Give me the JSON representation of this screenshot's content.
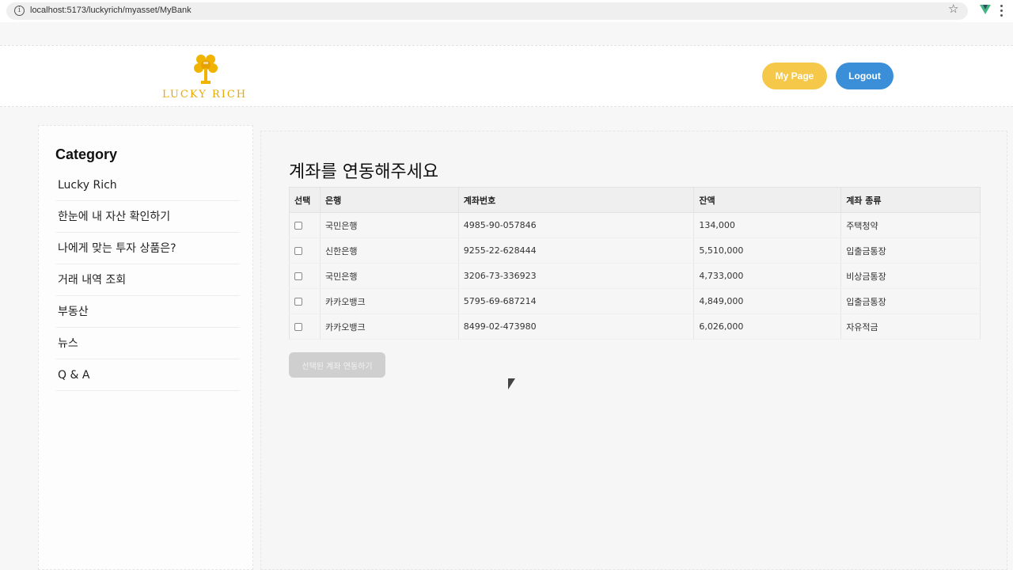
{
  "browser": {
    "url": "localhost:5173/luckyrich/myasset/MyBank"
  },
  "header": {
    "logo_text": "LUCKY RICH",
    "mypage_label": "My Page",
    "logout_label": "Logout"
  },
  "sidebar": {
    "title": "Category",
    "items": [
      {
        "label": "Lucky Rich"
      },
      {
        "label": "한눈에 내 자산 확인하기"
      },
      {
        "label": "나에게 맞는 투자 상품은?"
      },
      {
        "label": "거래 내역 조회"
      },
      {
        "label": "부동산"
      },
      {
        "label": "뉴스"
      },
      {
        "label": "Q & A"
      }
    ]
  },
  "main": {
    "title": "계좌를 연동해주세요",
    "table": {
      "headers": [
        "선택",
        "은행",
        "계좌번호",
        "잔액",
        "계좌 종류"
      ],
      "rows": [
        {
          "bank": "국민은행",
          "account": "4985-90-057846",
          "balance": "134,000",
          "type": "주택청약"
        },
        {
          "bank": "신한은행",
          "account": "9255-22-628444",
          "balance": "5,510,000",
          "type": "입출금통장"
        },
        {
          "bank": "국민은행",
          "account": "3206-73-336923",
          "balance": "4,733,000",
          "type": "비상금통장"
        },
        {
          "bank": "카카오뱅크",
          "account": "5795-69-687214",
          "balance": "4,849,000",
          "type": "입출금통장"
        },
        {
          "bank": "카카오뱅크",
          "account": "8499-02-473980",
          "balance": "6,026,000",
          "type": "자유적금"
        }
      ]
    },
    "link_button_label": "선택된 계좌 연동하기"
  },
  "colors": {
    "mypage_button": "#f6c84a",
    "logout_button": "#3a8fd8",
    "logo": "#e8a800",
    "disabled_button": "#cfcfcf"
  }
}
